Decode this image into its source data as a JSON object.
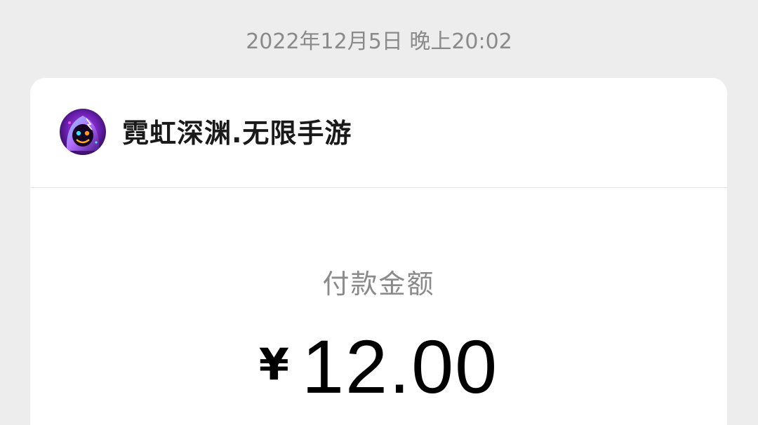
{
  "timestamp": "2022年12月5日 晚上20:02",
  "merchant": {
    "name": "霓虹深渊.无限手游",
    "avatar_icon": "neon-abyss-character-avatar"
  },
  "payment": {
    "label": "付款金额",
    "currency": "¥",
    "amount": "12.00"
  },
  "colors": {
    "background": "#ededed",
    "card": "#ffffff",
    "muted_text": "#8a8a8a",
    "primary_text": "#1a1a1a"
  }
}
